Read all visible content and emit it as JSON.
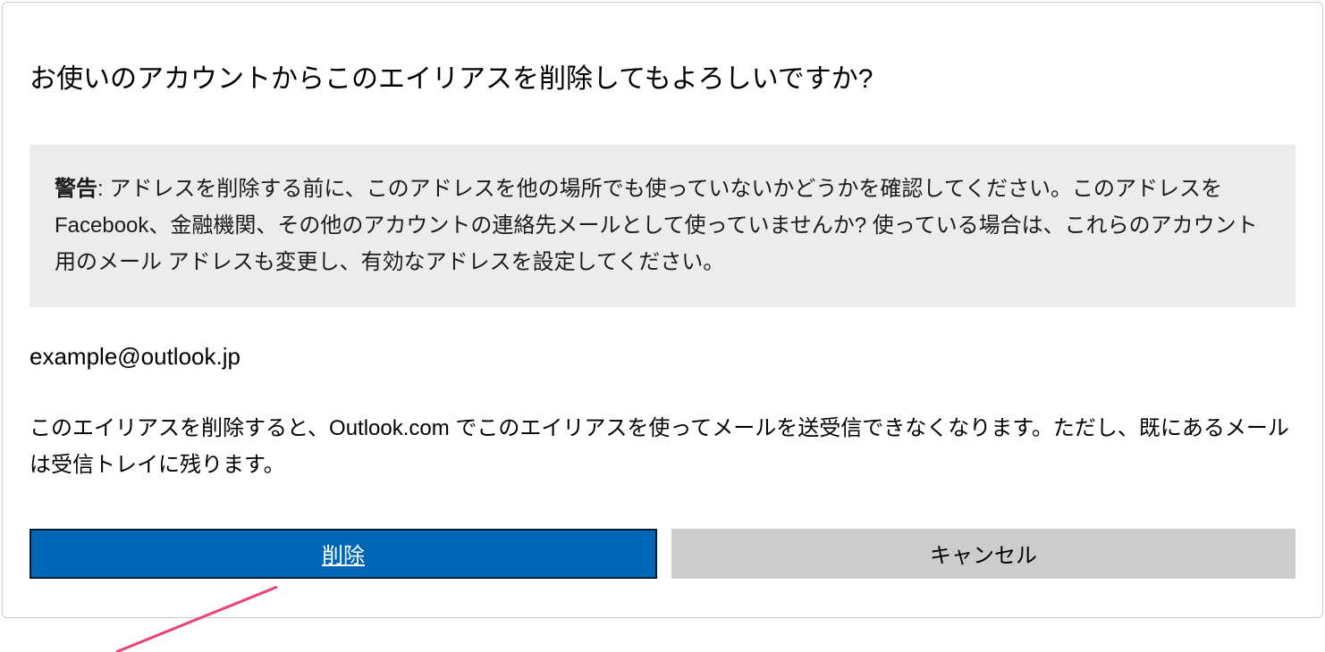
{
  "dialog": {
    "title": "お使いのアカウントからこのエイリアスを削除してもよろしいですか?",
    "warning_label": "警告",
    "warning_text": ": アドレスを削除する前に、このアドレスを他の場所でも使っていないかどうかを確認してください。このアドレスを Facebook、金融機関、その他のアカウントの連絡先メールとして使っていませんか? 使っている場合は、これらのアカウント用のメール アドレスも変更し、有効なアドレスを設定してください。",
    "email": "example@outlook.jp",
    "note": "このエイリアスを削除すると、Outlook.com でこのエイリアスを使ってメールを送受信できなくなります。ただし、既にあるメールは受信トレイに残ります。",
    "delete_label": "削除",
    "cancel_label": "キャンセル"
  }
}
